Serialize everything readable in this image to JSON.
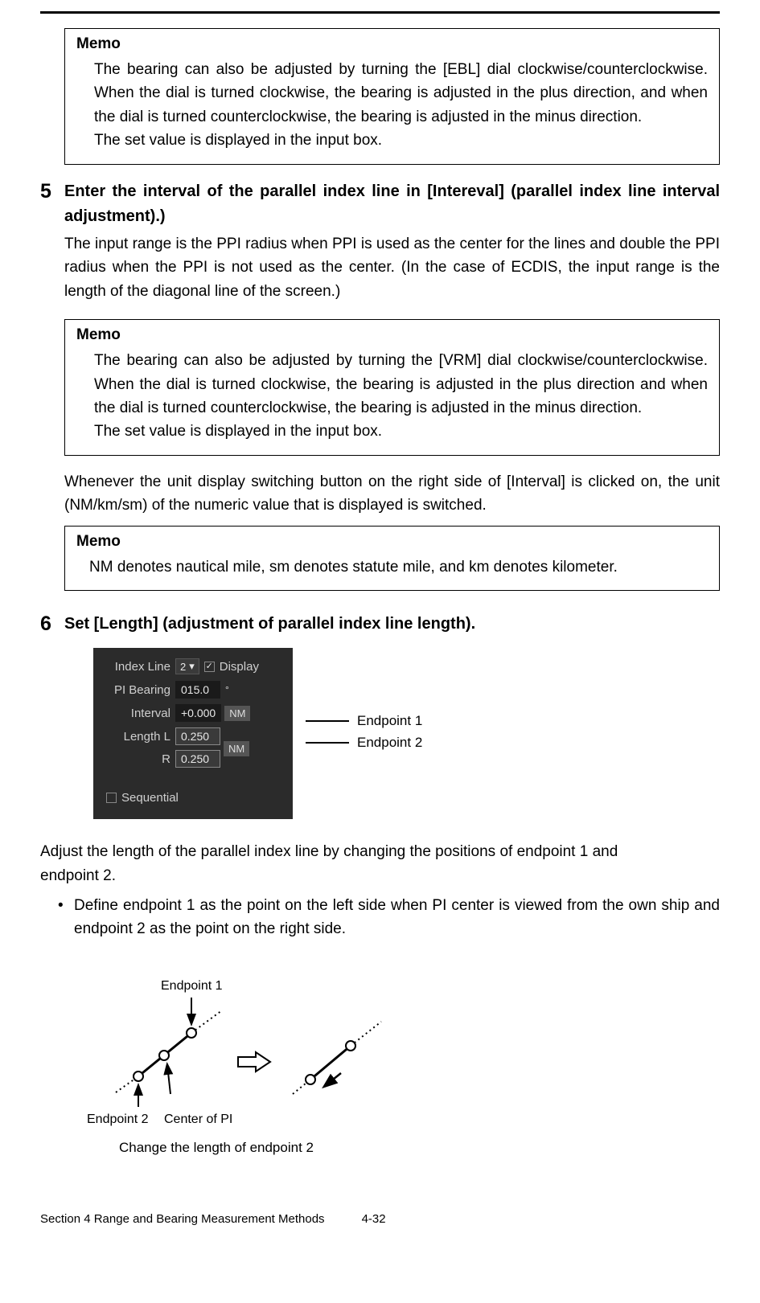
{
  "memo1": {
    "title": "Memo",
    "body": "The bearing can also be adjusted by turning the [EBL] dial clockwise/counterclockwise. When the dial is turned clockwise, the bearing is adjusted in the plus direction, and when the dial is turned counterclockwise, the bearing is adjusted in the minus direction.\nThe set value is displayed in the input box."
  },
  "step5": {
    "num": "5",
    "head": "Enter the interval of the parallel index line in [Intereval] (parallel index line interval adjustment).)",
    "desc": "The input range is the PPI radius when PPI is used as the center for the lines and double the PPI radius when the PPI is not used as the center. (In the case of ECDIS, the input range is the length of the diagonal line of the screen.)"
  },
  "memo2": {
    "title": "Memo",
    "body": "The bearing can also be adjusted by turning the [VRM] dial clockwise/counterclockwise. When the dial is turned clockwise, the bearing is adjusted in the plus direction and when the dial is turned counterclockwise, the bearing is adjusted in the minus direction.\nThe set value is displayed in the input box."
  },
  "after5": "Whenever the unit display switching button on the right side of [Interval] is clicked on, the unit (NM/km/sm) of the numeric value that is displayed is switched.",
  "memo3": {
    "title": "Memo",
    "body": "NM denotes nautical mile, sm denotes statute mile, and km denotes kilometer."
  },
  "step6": {
    "num": "6",
    "head": "Set [Length] (adjustment of parallel index line length)."
  },
  "ui": {
    "index_line_label": "Index Line",
    "index_line_value": "2",
    "display_label": "Display",
    "pi_bearing_label": "PI Bearing",
    "pi_bearing_value": "015.0",
    "interval_label": "Interval",
    "interval_value": "+0.000",
    "interval_unit": "NM",
    "length_l_label": "Length L",
    "length_l_value": "0.250",
    "length_r_label": "R",
    "length_r_value": "0.250",
    "length_unit": "NM",
    "sequential_label": "Sequential"
  },
  "callouts": {
    "ep1": "Endpoint 1",
    "ep2": "Endpoint 2"
  },
  "adjust_para": "Adjust the length of the parallel index line by changing the positions of endpoint 1 and endpoint 2.",
  "bullet": "Define endpoint 1 as the point on the left side when PI center is viewed from the own ship and endpoint 2 as the point on the right side.",
  "dia": {
    "ep1": "Endpoint 1",
    "ep2": "Endpoint 2",
    "center": "Center of PI",
    "caption": "Change the length of endpoint 2"
  },
  "footer": {
    "section": "Section 4    Range and Bearing Measurement Methods",
    "page": "4-32"
  }
}
